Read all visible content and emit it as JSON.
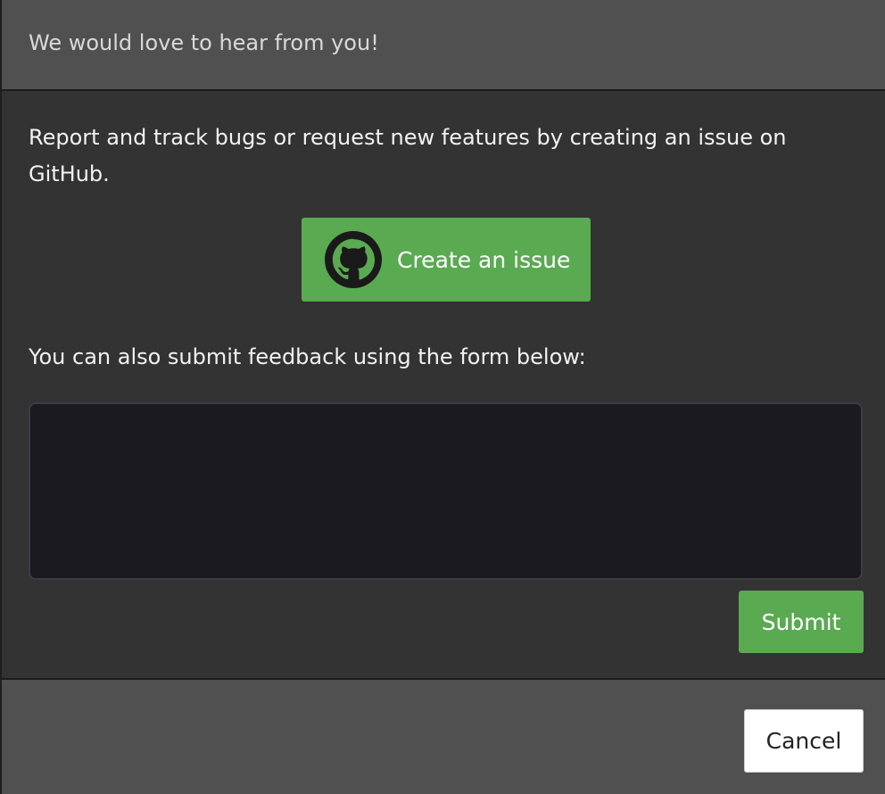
{
  "dialog": {
    "title": "We would love to hear from you!"
  },
  "body": {
    "intro_text": "Report and track bugs or request new features by creating an issue on GitHub.",
    "github_button": {
      "label": "Create an issue",
      "icon": "github-icon"
    },
    "form_label": "You can also submit feedback using the form below:",
    "feedback": {
      "value": "",
      "placeholder": ""
    },
    "submit_label": "Submit"
  },
  "footer": {
    "cancel_label": "Cancel"
  },
  "colors": {
    "accent_green": "#5aaa52",
    "header_bg": "#505050",
    "body_bg": "#333333",
    "input_bg": "#1b1a1f"
  }
}
